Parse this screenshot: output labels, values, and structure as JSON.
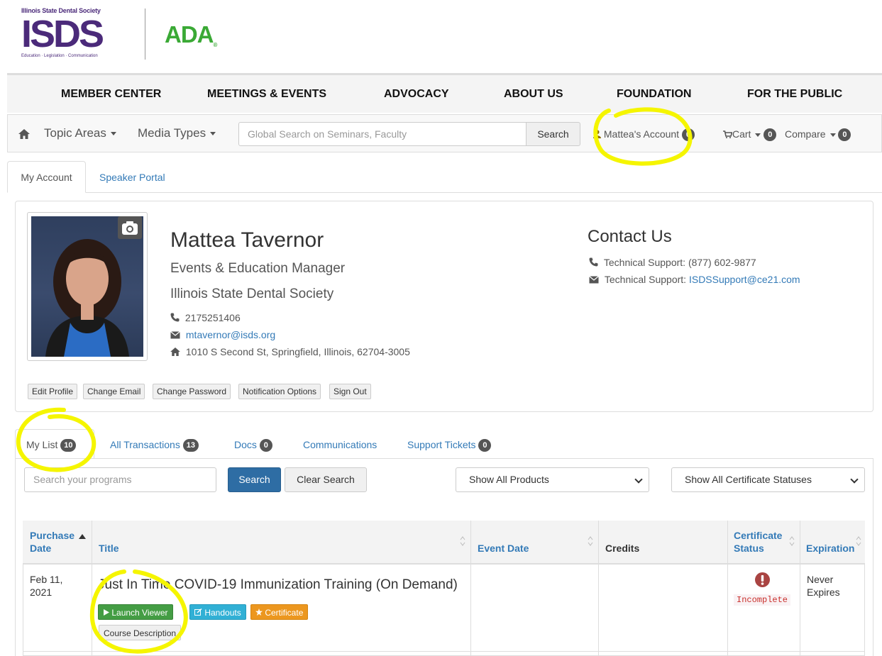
{
  "header": {
    "isds_logo": {
      "top_text": "Illinois State Dental Society",
      "word": "ISDS",
      "bottom_text": "Education · Legislation · Communication"
    },
    "ada_logo": "ADA"
  },
  "main_nav": [
    "MEMBER CENTER",
    "MEETINGS & EVENTS",
    "ADVOCACY",
    "ABOUT US",
    "FOUNDATION",
    "FOR THE PUBLIC"
  ],
  "subnav": {
    "topic_areas": "Topic Areas",
    "media_types": "Media Types",
    "search_placeholder": "Global Search on Seminars, Faculty",
    "search_button": "Search",
    "account": "Mattea's Account",
    "account_count": "0",
    "cart": "Cart",
    "cart_count": "0",
    "compare": "Compare",
    "compare_count": "0"
  },
  "account_tabs": {
    "active": "My Account",
    "other": "Speaker Portal"
  },
  "profile": {
    "name": "Mattea Tavernor",
    "title": "Events & Education Manager",
    "organization": "Illinois State Dental Society",
    "phone": "2175251406",
    "email": "mtavernor@isds.org",
    "address": "1010 S Second St, Springfield, Illinois, 62704-3005",
    "buttons": [
      "Edit Profile",
      "Change Email",
      "Change Password",
      "Notification Options",
      "Sign Out"
    ]
  },
  "contact": {
    "title": "Contact Us",
    "phone_line": "Technical Support: (877) 602-9877",
    "email_label": "Technical Support: ",
    "email": "ISDSSupport@ce21.com"
  },
  "list_tabs": [
    {
      "label": "My List",
      "count": "10"
    },
    {
      "label": "All Transactions",
      "count": "13"
    },
    {
      "label": "Docs",
      "count": "0"
    },
    {
      "label": "Communications",
      "count": ""
    },
    {
      "label": "Support Tickets",
      "count": "0"
    }
  ],
  "filters": {
    "search_placeholder": "Search your programs",
    "search_button": "Search",
    "clear_button": "Clear Search",
    "products_select": "Show All Products",
    "certificate_select": "Show All Certificate Statuses"
  },
  "table": {
    "headers": {
      "purchase_date": [
        "Purchase",
        "Date"
      ],
      "title": "Title",
      "event_date": "Event Date",
      "credits": "Credits",
      "certificate_status": [
        "Certificate",
        "Status"
      ],
      "expiration": "Expiration"
    },
    "rows": [
      {
        "purchase_date": [
          "Feb 11,",
          "2021"
        ],
        "title": "Just In Time COVID-19 Immunization Training (On Demand)",
        "buttons": {
          "launch": "Launch Viewer",
          "handouts": "Handouts",
          "certificate": "Certificate",
          "description": "Course Description"
        },
        "status": "Incomplete",
        "expiration": [
          "Never",
          "Expires"
        ]
      }
    ]
  },
  "colors": {
    "isds_purple": "#4b2a7a",
    "ada_green": "#3aa935",
    "link": "#337ab7",
    "highlight": "#f5f500"
  }
}
